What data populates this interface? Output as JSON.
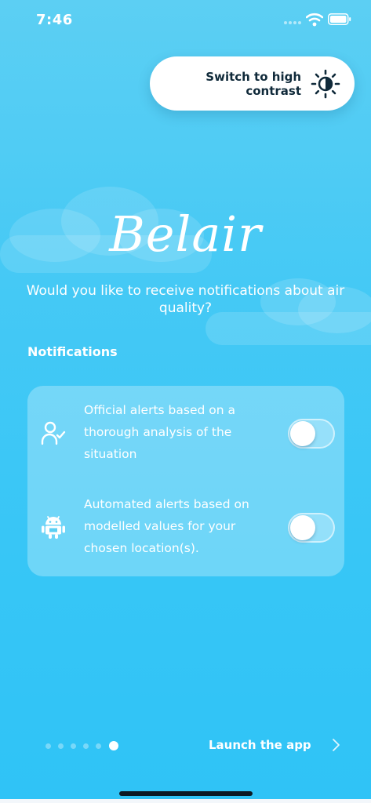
{
  "status_bar": {
    "time": "7:46"
  },
  "contrast_toggle": {
    "label": "Switch to high contrast"
  },
  "brand": {
    "logo_text": "Belair"
  },
  "onboarding": {
    "question": "Would you like to receive notifications about air quality?",
    "section_title": "Notifications"
  },
  "notifications": {
    "options": [
      {
        "icon": "user-check-icon",
        "text": "Official alerts based on a thorough analysis of the situation",
        "enabled": false
      },
      {
        "icon": "android-robot-icon",
        "text": "Automated alerts based on modelled values for your chosen location(s).",
        "enabled": false
      }
    ]
  },
  "pager": {
    "total_pages": 6,
    "current_page": 6
  },
  "footer": {
    "launch_label": "Launch the app"
  },
  "colors": {
    "background_top": "#5ccff3",
    "background_bottom": "#2fc3f6",
    "text_dark": "#102a3a",
    "white": "#ffffff"
  }
}
